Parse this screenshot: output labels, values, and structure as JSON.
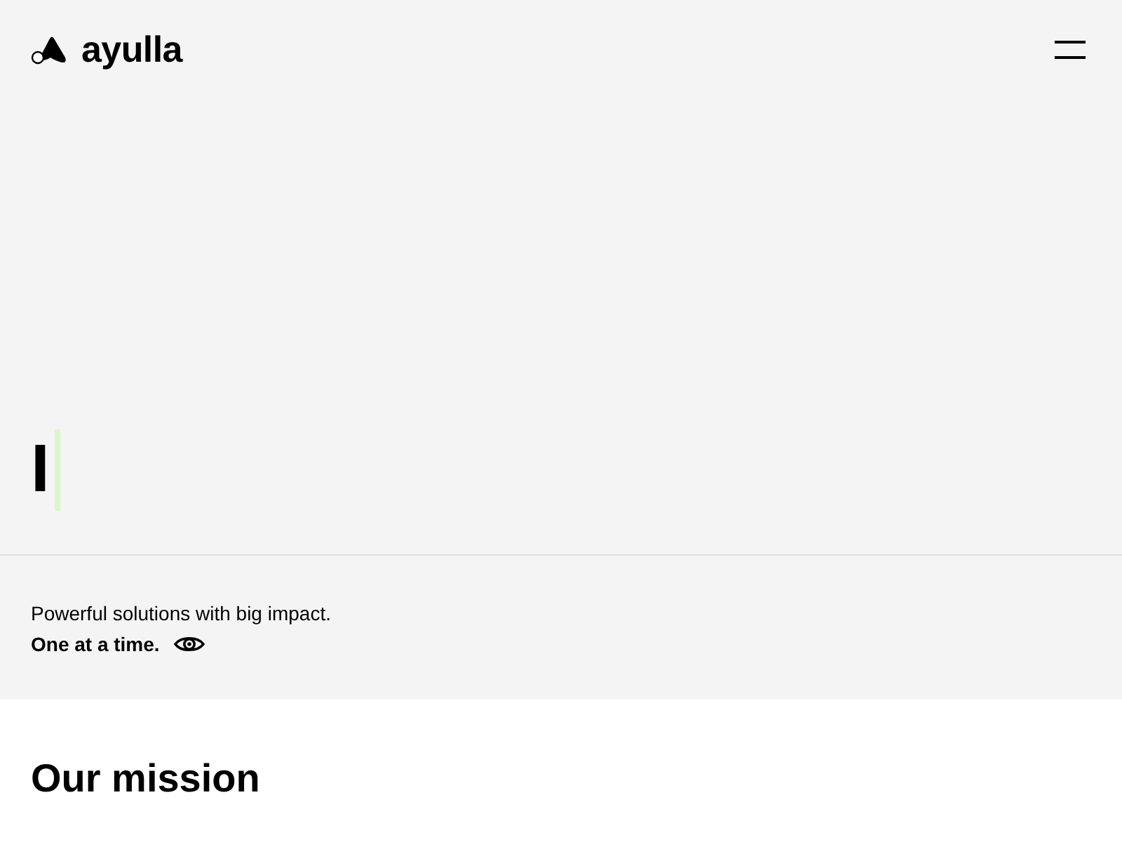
{
  "header": {
    "logo_text": "ayulla"
  },
  "hero": {
    "heading": "I"
  },
  "tagline": {
    "lines": [
      {
        "text": "Powerful solutions with big impact.",
        "kind": "plain"
      },
      {
        "text": "One at a time.",
        "kind": "emphasis"
      }
    ]
  },
  "mission": {
    "title": "Our mission"
  }
}
